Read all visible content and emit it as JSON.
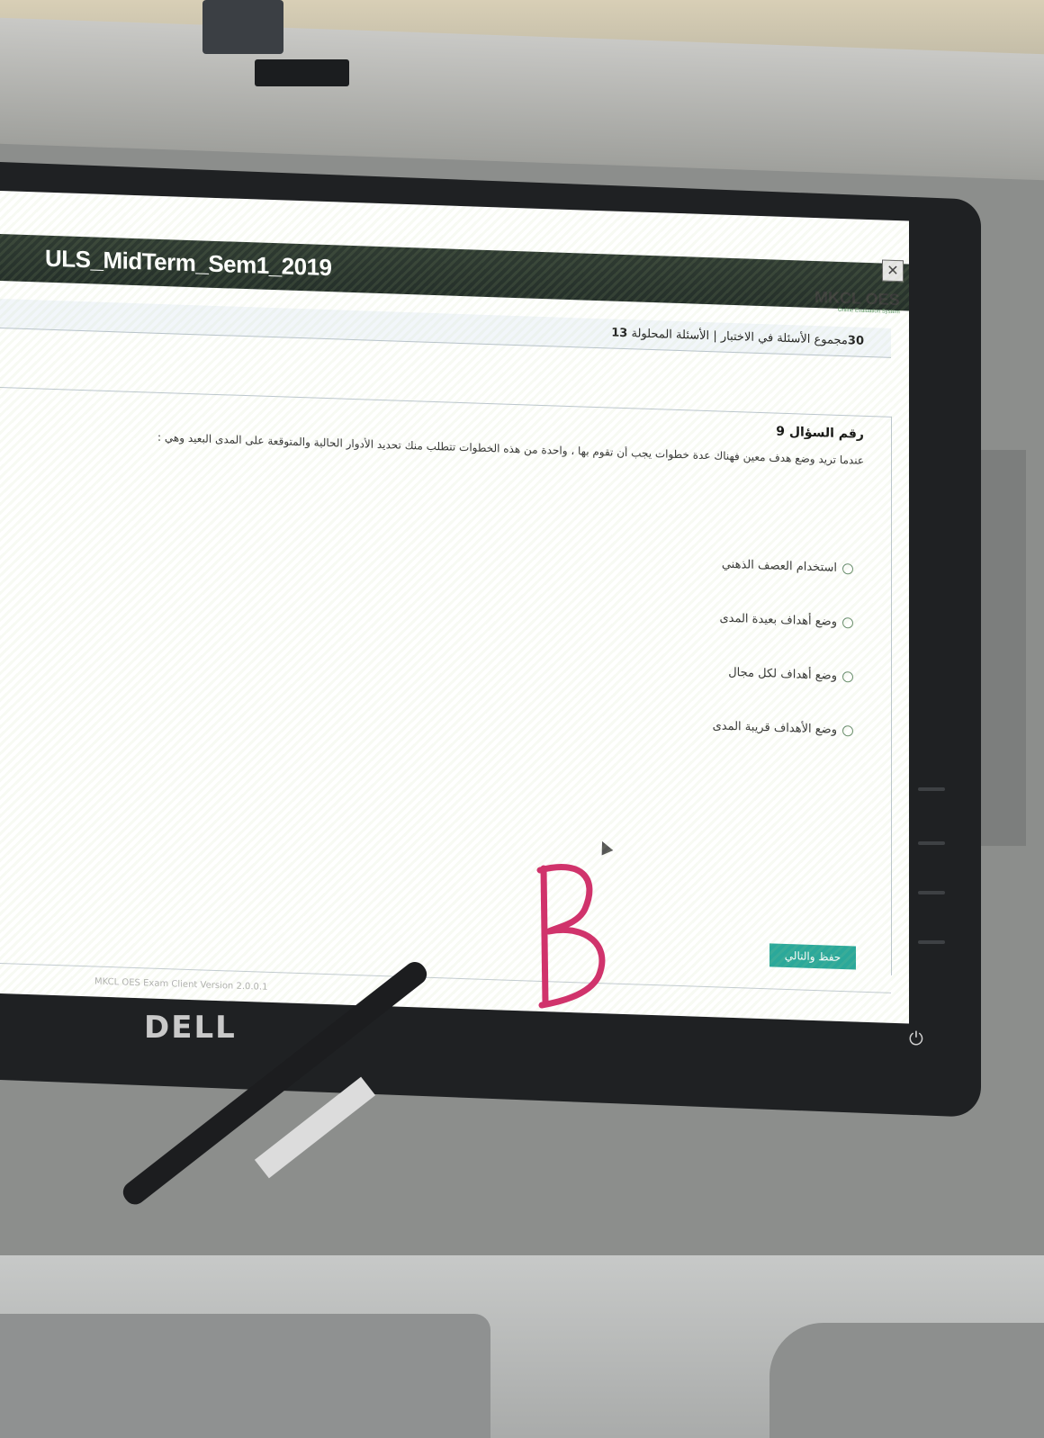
{
  "window": {
    "title": "ULS_MidTerm_Sem1_2019",
    "close_symbol": "✕",
    "logo": "MKCL OES",
    "logo_subtitle": "Online Evaluation System"
  },
  "stats": {
    "total_count": "30",
    "total_label": "مجموع الأسئلة في الاختبار",
    "separator": "|",
    "answered_label": "الأسئلة المحلولة",
    "answered_count": "13"
  },
  "question": {
    "number_label": "رقم السؤال 9",
    "text": "عندما تريد وضع هدف معين فهناك عدة خطوات يجب أن تقوم بها ، واحدة من هذه الخطوات تتطلب منك تحديد الأدوار الحالية والمتوقعة على المدى البعيد وهي :",
    "options": [
      "استخدام العصف الذهني",
      "وضع أهداف بعيدة المدى",
      "وضع أهداف لكل مجال",
      "وضع الأهداف قريبة المدى"
    ]
  },
  "buttons": {
    "save_next": "حفظ والتالي"
  },
  "footer": {
    "version": "MKCL OES Exam Client Version 2.0.0.1"
  },
  "monitor": {
    "brand": "DELL"
  },
  "annotation": {
    "letter": "B",
    "color": "#d0336b"
  }
}
